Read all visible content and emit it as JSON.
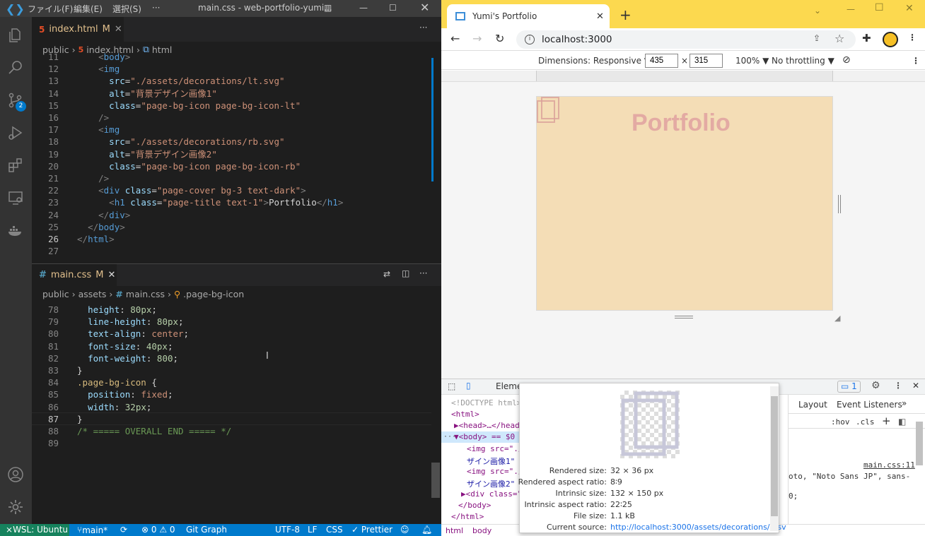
{
  "vscode": {
    "menu": [
      "ファイル(F)",
      "編集(E)",
      "選択(S)",
      "···"
    ],
    "window_title": "main.css - web-portfolio-yumi...",
    "scm_badge": "2",
    "editor1": {
      "tab_label": "index.html",
      "tab_modified": "M",
      "breadcrumb": [
        "public",
        "index.html",
        "html"
      ],
      "lines": [
        {
          "n": "11",
          "html": "    <span class='gr'>&lt;</span><span class='tg'>body</span><span class='gr'>&gt;</span>"
        },
        {
          "n": "12",
          "html": "    <span class='gr'>&lt;</span><span class='tg'>img</span>"
        },
        {
          "n": "13",
          "html": "      <span class='at'>src</span>=<span class='st'>\"./assets/decorations/lt.svg\"</span>"
        },
        {
          "n": "14",
          "html": "      <span class='at'>alt</span>=<span class='st'>\"背景デザイン画像1\"</span>"
        },
        {
          "n": "15",
          "html": "      <span class='at'>class</span>=<span class='st'>\"page-bg-icon page-bg-icon-lt\"</span>"
        },
        {
          "n": "16",
          "html": "    <span class='gr'>/&gt;</span>"
        },
        {
          "n": "17",
          "html": "    <span class='gr'>&lt;</span><span class='tg'>img</span>"
        },
        {
          "n": "18",
          "html": "      <span class='at'>src</span>=<span class='st'>\"./assets/decorations/rb.svg\"</span>"
        },
        {
          "n": "19",
          "html": "      <span class='at'>alt</span>=<span class='st'>\"背景デザイン画像2\"</span>"
        },
        {
          "n": "20",
          "html": "      <span class='at'>class</span>=<span class='st'>\"page-bg-icon page-bg-icon-rb\"</span>"
        },
        {
          "n": "21",
          "html": "    <span class='gr'>/&gt;</span>"
        },
        {
          "n": "22",
          "html": "    <span class='gr'>&lt;</span><span class='tg'>div</span> <span class='at'>class</span>=<span class='st'>\"page-cover bg-3 text-dark\"</span><span class='gr'>&gt;</span>"
        },
        {
          "n": "23",
          "html": "      <span class='gr'>&lt;</span><span class='tg'>h1</span> <span class='at'>class</span>=<span class='st'>\"page-title text-1\"</span><span class='gr'>&gt;</span>Portfolio<span class='gr'>&lt;/</span><span class='tg'>h1</span><span class='gr'>&gt;</span>"
        },
        {
          "n": "24",
          "html": "    <span class='gr'>&lt;/</span><span class='tg'>div</span><span class='gr'>&gt;</span>"
        },
        {
          "n": "25",
          "html": "  <span class='gr'>&lt;/</span><span class='tg'>body</span><span class='gr'>&gt;</span>"
        },
        {
          "n": "26",
          "html": "<span class='gr'>&lt;/</span><span class='tg'>html</span><span class='gr'>&gt;</span>"
        },
        {
          "n": "27",
          "html": ""
        }
      ]
    },
    "editor2": {
      "tab_label": "main.css",
      "tab_modified": "M",
      "breadcrumb": [
        "public",
        "assets",
        "main.css",
        ".page-bg-icon"
      ],
      "lines": [
        {
          "n": "78",
          "html": "  <span class='pr'>height</span>: <span class='nm'>80px</span>;"
        },
        {
          "n": "79",
          "html": "  <span class='pr'>line-height</span>: <span class='nm'>80px</span>;"
        },
        {
          "n": "80",
          "html": "  <span class='pr'>text-align</span>: <span class='vl'>center</span>;"
        },
        {
          "n": "81",
          "html": "  <span class='pr'>font-size</span>: <span class='nm'>40px</span>;"
        },
        {
          "n": "82",
          "html": "  <span class='pr'>font-weight</span>: <span class='nm'>800</span>;"
        },
        {
          "n": "83",
          "html": "<span class='tx'>}</span>"
        },
        {
          "n": "84",
          "html": "<span class='sel'>.page-bg-icon</span> <span class='tx'>{</span>"
        },
        {
          "n": "85",
          "html": "  <span class='pr'>position</span>: <span class='vl'>fixed</span>;"
        },
        {
          "n": "86",
          "html": "  <span class='pr'>width</span>: <span class='nm'>32px</span>;"
        },
        {
          "n": "87",
          "html": "<span class='tx'>}</span>"
        },
        {
          "n": "88",
          "html": "<span class='cm'>/* ===== OVERALL END ===== */</span>"
        },
        {
          "n": "89",
          "html": ""
        }
      ]
    },
    "status": {
      "remote": "WSL: Ubuntu",
      "branch": "main*",
      "problems": "⊗ 0 ⚠ 0",
      "git_graph": "Git Graph",
      "encoding": "UTF-8",
      "eol": "LF",
      "language": "CSS",
      "prettier": "✓ Prettier"
    }
  },
  "chrome": {
    "tab_title": "Yumi's Portfolio",
    "url": "localhost:3000",
    "device_toolbar": {
      "dimensions_label": "Dimensions: Responsive ▼",
      "width": "435",
      "times": "×",
      "height": "315",
      "zoom": "100% ▼",
      "throttle": "No throttling ▼"
    },
    "page": {
      "title": "Portfolio"
    },
    "devtools": {
      "panel_tab": "Eleme",
      "issues_count": "1",
      "right_tabs": [
        "Layout",
        "Event Listeners",
        "»"
      ],
      "filter_buttons": [
        ":hov",
        ".cls",
        "+"
      ],
      "elements_lines": [
        "<!DOCTYPE html>",
        "<html>",
        "▶<head>…</head>",
        "▼<body> == $0",
        "<img src=\"./",
        "ザイン画像1\"",
        "<img src=\"./",
        "ザイン画像2\"",
        "▶<div class=\"",
        "</body>",
        "</html>"
      ],
      "styles_source": "main.css:11",
      "styles_line1": "oto, \"Noto Sans JP\", sans-",
      "styles_line2": "0;",
      "styles_line3": ";",
      "bottom_crumbs": [
        "html",
        "body"
      ],
      "popup": {
        "rendered_size_label": "Rendered size:",
        "rendered_size": "32 × 36 px",
        "rendered_ratio_label": "Rendered aspect ratio:",
        "rendered_ratio": "8∶9",
        "intrinsic_size_label": "Intrinsic size:",
        "intrinsic_size": "132 × 150 px",
        "intrinsic_ratio_label": "Intrinsic aspect ratio:",
        "intrinsic_ratio": "22∶25",
        "file_size_label": "File size:",
        "file_size": "1.1 kB",
        "current_source_label": "Current source:",
        "current_source": "http://localhost:3000/assets/decorations/lt.sv"
      }
    }
  },
  "colors": {
    "vscode_bg": "#1e1e1e",
    "statusbar": "#007acc",
    "chrome_tabbar": "#fcd94f",
    "page_bg": "#f4ddb6",
    "title_color": "#e3aaa3"
  }
}
